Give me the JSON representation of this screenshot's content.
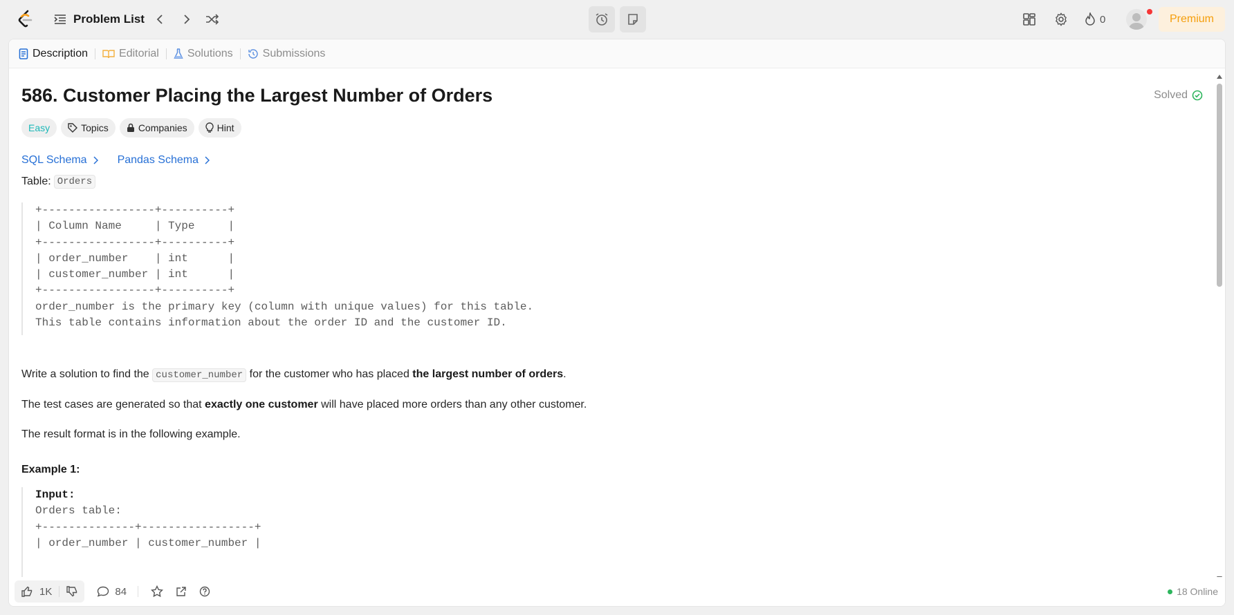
{
  "topbar": {
    "problem_list_label": "Problem List",
    "streak_count": "0",
    "premium_label": "Premium",
    "icons": [
      "leetcode-logo-icon",
      "list-icon",
      "chevron-left-icon",
      "chevron-right-icon",
      "shuffle-icon",
      "alarm-clock-icon",
      "note-icon",
      "layout-grid-icon",
      "gear-icon",
      "flame-icon",
      "user-avatar-icon"
    ]
  },
  "tabs": [
    {
      "label": "Description",
      "icon": "document-icon"
    },
    {
      "label": "Editorial",
      "icon": "book-icon"
    },
    {
      "label": "Solutions",
      "icon": "flask-icon"
    },
    {
      "label": "Submissions",
      "icon": "history-icon"
    }
  ],
  "problem": {
    "title": "586. Customer Placing the Largest Number of Orders",
    "status": "Solved",
    "difficulty": "Easy",
    "tags": [
      "Topics",
      "Companies",
      "Hint"
    ],
    "schemas": [
      "SQL Schema",
      "Pandas Schema"
    ],
    "table_label": "Table:",
    "table_name": "Orders",
    "schema_block": "+-----------------+----------+\n| Column Name     | Type     |\n+-----------------+----------+\n| order_number    | int      |\n| customer_number | int      |\n+-----------------+----------+\norder_number is the primary key (column with unique values) for this table.\nThis table contains information about the order ID and the customer ID.",
    "p1_before": "Write a solution to find the ",
    "p1_code": "customer_number",
    "p1_middle": " for the customer who has placed ",
    "p1_bold": "the largest number of orders",
    "p1_after": ".",
    "p2_before": "The test cases are generated so that ",
    "p2_bold": "exactly one customer",
    "p2_after": " will have placed more orders than any other customer.",
    "p3": "The result format is in the following example.",
    "example_title": "Example 1:",
    "example_input_label": "Input:",
    "example_block": "Orders table:\n+--------------+-----------------+\n| order_number | customer_number |"
  },
  "bottombar": {
    "likes": "1K",
    "comments": "84",
    "online": "18 Online"
  },
  "colors": {
    "accent_blue": "#2770d6",
    "easy": "#1cb8b8",
    "solved_green": "#2db55d",
    "premium": "#f59e0b"
  }
}
